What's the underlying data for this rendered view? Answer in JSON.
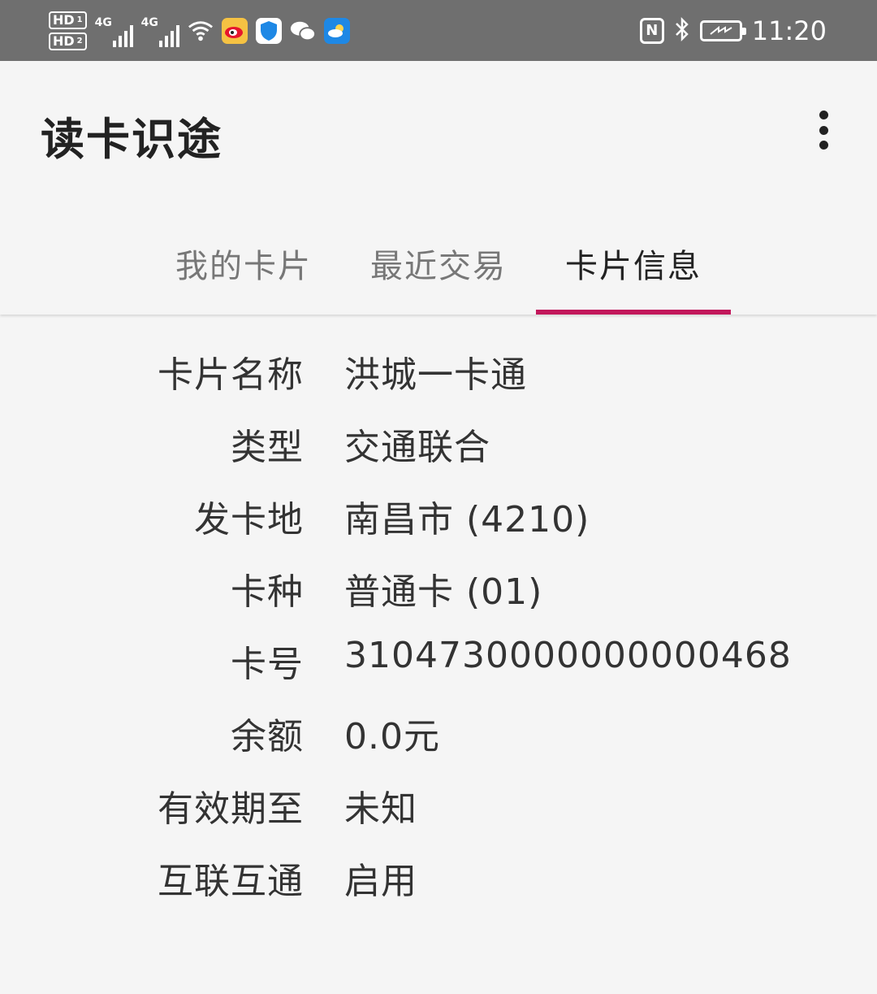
{
  "status_bar": {
    "hd1": "HD",
    "hd1_sub": "1",
    "hd2": "HD",
    "hd2_sub": "2",
    "net1": "4G",
    "net2": "4G",
    "nfc": "N",
    "time": "11:20",
    "icons": [
      "weibo-icon",
      "shield-icon",
      "wechat-icon",
      "weather-icon"
    ],
    "colors": {
      "weibo": "#f5c243",
      "shield": "#1e88e5",
      "weather": "#1e88e5"
    }
  },
  "app_bar": {
    "title": "读卡识途"
  },
  "tabs": [
    {
      "label": "我的卡片",
      "active": false
    },
    {
      "label": "最近交易",
      "active": false
    },
    {
      "label": "卡片信息",
      "active": true
    }
  ],
  "accent_color": "#c2185b",
  "card_info": [
    {
      "label": "卡片名称",
      "value": "洪城一卡通"
    },
    {
      "label": "类型",
      "value": "交通联合"
    },
    {
      "label": "发卡地",
      "value": "南昌市 (4210)"
    },
    {
      "label": "卡种",
      "value": "普通卡 (01)"
    },
    {
      "label": "卡号",
      "value": "3104730000000000468"
    },
    {
      "label": "余额",
      "value": "0.0元"
    },
    {
      "label": "有效期至",
      "value": "未知"
    },
    {
      "label": "互联互通",
      "value": "启用"
    }
  ]
}
